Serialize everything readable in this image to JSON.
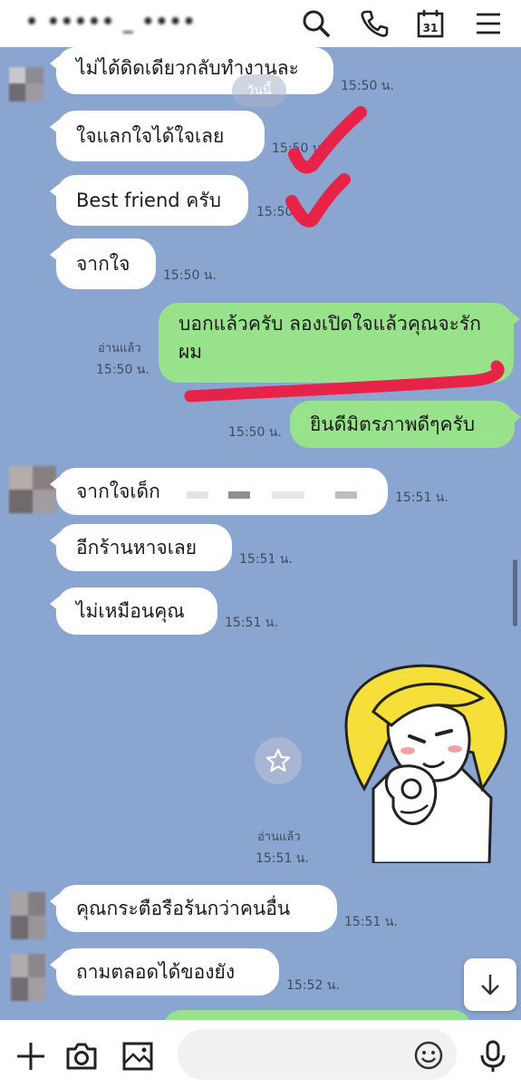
{
  "header": {
    "contact_name": "• ••••• _ ••••"
  },
  "day_badge": "วันนี้",
  "messages": [
    {
      "dir": "in",
      "text": "ไม่ได้ดิดเดียวกลับทำงานละ",
      "time": "15:50 น."
    },
    {
      "dir": "in",
      "text": "ใจแลกใจได้ใจเลย",
      "time": "15:50 น."
    },
    {
      "dir": "in",
      "text": "Best friend ครับ",
      "time": "15:50 น."
    },
    {
      "dir": "in",
      "text": "จากใจ",
      "time": "15:50 น."
    },
    {
      "dir": "out",
      "text": "บอกแล้วครับ ลองเปิดใจแล้วคุณจะรักผม",
      "time": "15:50 น.",
      "read": "อ่านแล้ว"
    },
    {
      "dir": "out",
      "text": "ยินดีมิตรภาพดีๆครับ",
      "time": "15:50 น."
    },
    {
      "dir": "in",
      "text": "จากใจเด็ก",
      "time": "15:51 น."
    },
    {
      "dir": "in",
      "text": "อีกร้านหาจเลย",
      "time": "15:51 น."
    },
    {
      "dir": "in",
      "text": "ไม่เหมือนคุณ",
      "time": "15:51 น."
    },
    {
      "dir": "out",
      "type": "sticker",
      "time": "15:51 น.",
      "read": "อ่านแล้ว"
    },
    {
      "dir": "in",
      "text": "คุณกระตือรือร้นกว่าคนอื่น",
      "time": "15:51 น."
    },
    {
      "dir": "in",
      "text": "ถามตลอดได้ของยัง",
      "time": "15:52 น."
    }
  ],
  "icons": {
    "header": [
      "search-icon",
      "phone-icon",
      "calendar-icon",
      "menu-icon"
    ],
    "footer": [
      "plus-icon",
      "camera-icon",
      "image-icon",
      "emoji-icon",
      "microphone-icon"
    ],
    "calendar_day": "31",
    "star_button": "star-icon",
    "scroll_button": "arrow-down-icon"
  },
  "composer": {
    "placeholder": ""
  },
  "colors": {
    "chat_background": "#8aa5cf",
    "incoming_bubble": "#ffffff",
    "outgoing_bubble": "#97e28b",
    "annotation_red": "#e8234a",
    "sticker_hair": "#f7df3a"
  }
}
